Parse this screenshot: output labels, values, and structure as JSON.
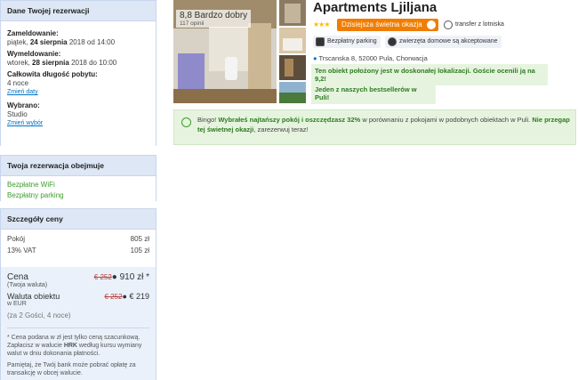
{
  "reservation": {
    "heading": "Dane Twojej rezerwacji",
    "checkin_label": "Zameldowanie:",
    "checkin_day": "piątek,",
    "checkin_date": "24 sierpnia",
    "checkin_rest": "2018 od 14:00",
    "checkout_label": "Wymeldowanie:",
    "checkout_day": "wtorek,",
    "checkout_date": "28 sierpnia",
    "checkout_rest": "2018 do 10:00",
    "length_label": "Całkowita długość pobytu:",
    "length_value": "4 noce",
    "change_dates": "Zmień daty",
    "selected_label": "Wybrano:",
    "selected_value": "Studio",
    "change_selection": "Zmień wybór"
  },
  "includes": {
    "heading": "Twoja rezerwacja obejmuje",
    "items": [
      "Bezpłatne WiFi",
      "Bezpłatny parking"
    ]
  },
  "price": {
    "heading": "Szczegóły ceny",
    "room_label": "Pokój",
    "room_value": "805 zł",
    "vat_label": "13% VAT",
    "vat_value": "105 zł",
    "total_label": "Cena",
    "total_sub": "(Twoja waluta)",
    "total_old": "€ 252",
    "total_new": "910 zł",
    "total_mark": "*",
    "local_label": "Waluta obiektu",
    "local_sub": "w EUR",
    "local_old": "€ 252",
    "local_new": "€ 219",
    "guests": "(za 2 Gości, 4 noce)",
    "note1_a": "* Cena podana w zł jest tylko ceną szacunkową. Zapłacisz w walucie ",
    "note1_cur": "HRK",
    "note1_b": " według kursu wymiany walut w dniu dokonania płatności.",
    "note2": "Pamiętaj, że Twój bank może pobrać opłatę za transakcję w obcej walucie."
  },
  "property": {
    "title": "Apartments Ljiljana",
    "stars": "★★★",
    "deal": "Dzisiejsza świetna okazja",
    "transfer": "transfer z lotniska",
    "parking": "Bezpłatny parking",
    "pets": "zwierzęta domowe są akceptowane",
    "address": "Trscanska 8, 52000 Pula, Chorwacja",
    "location_msg": "Ten obiekt położony jest w doskonałej lokalizacji. Goście ocenili ją na 9,2!",
    "bestseller": "Jeden z naszych bestsellerów w Puli!",
    "score": "8,8 Bardzo dobry",
    "reviews": "117 opinii"
  },
  "bingo": {
    "a": "Bingo! ",
    "b": "Wybrałeś najtańszy pokój i oszczędzasz 32%",
    "c": " w porównaniu z pokojami w podobnych obiektach w Puli. ",
    "d": "Nie przegap tej świetnej okazji",
    "e": ", zarezerwuj teraz!"
  }
}
